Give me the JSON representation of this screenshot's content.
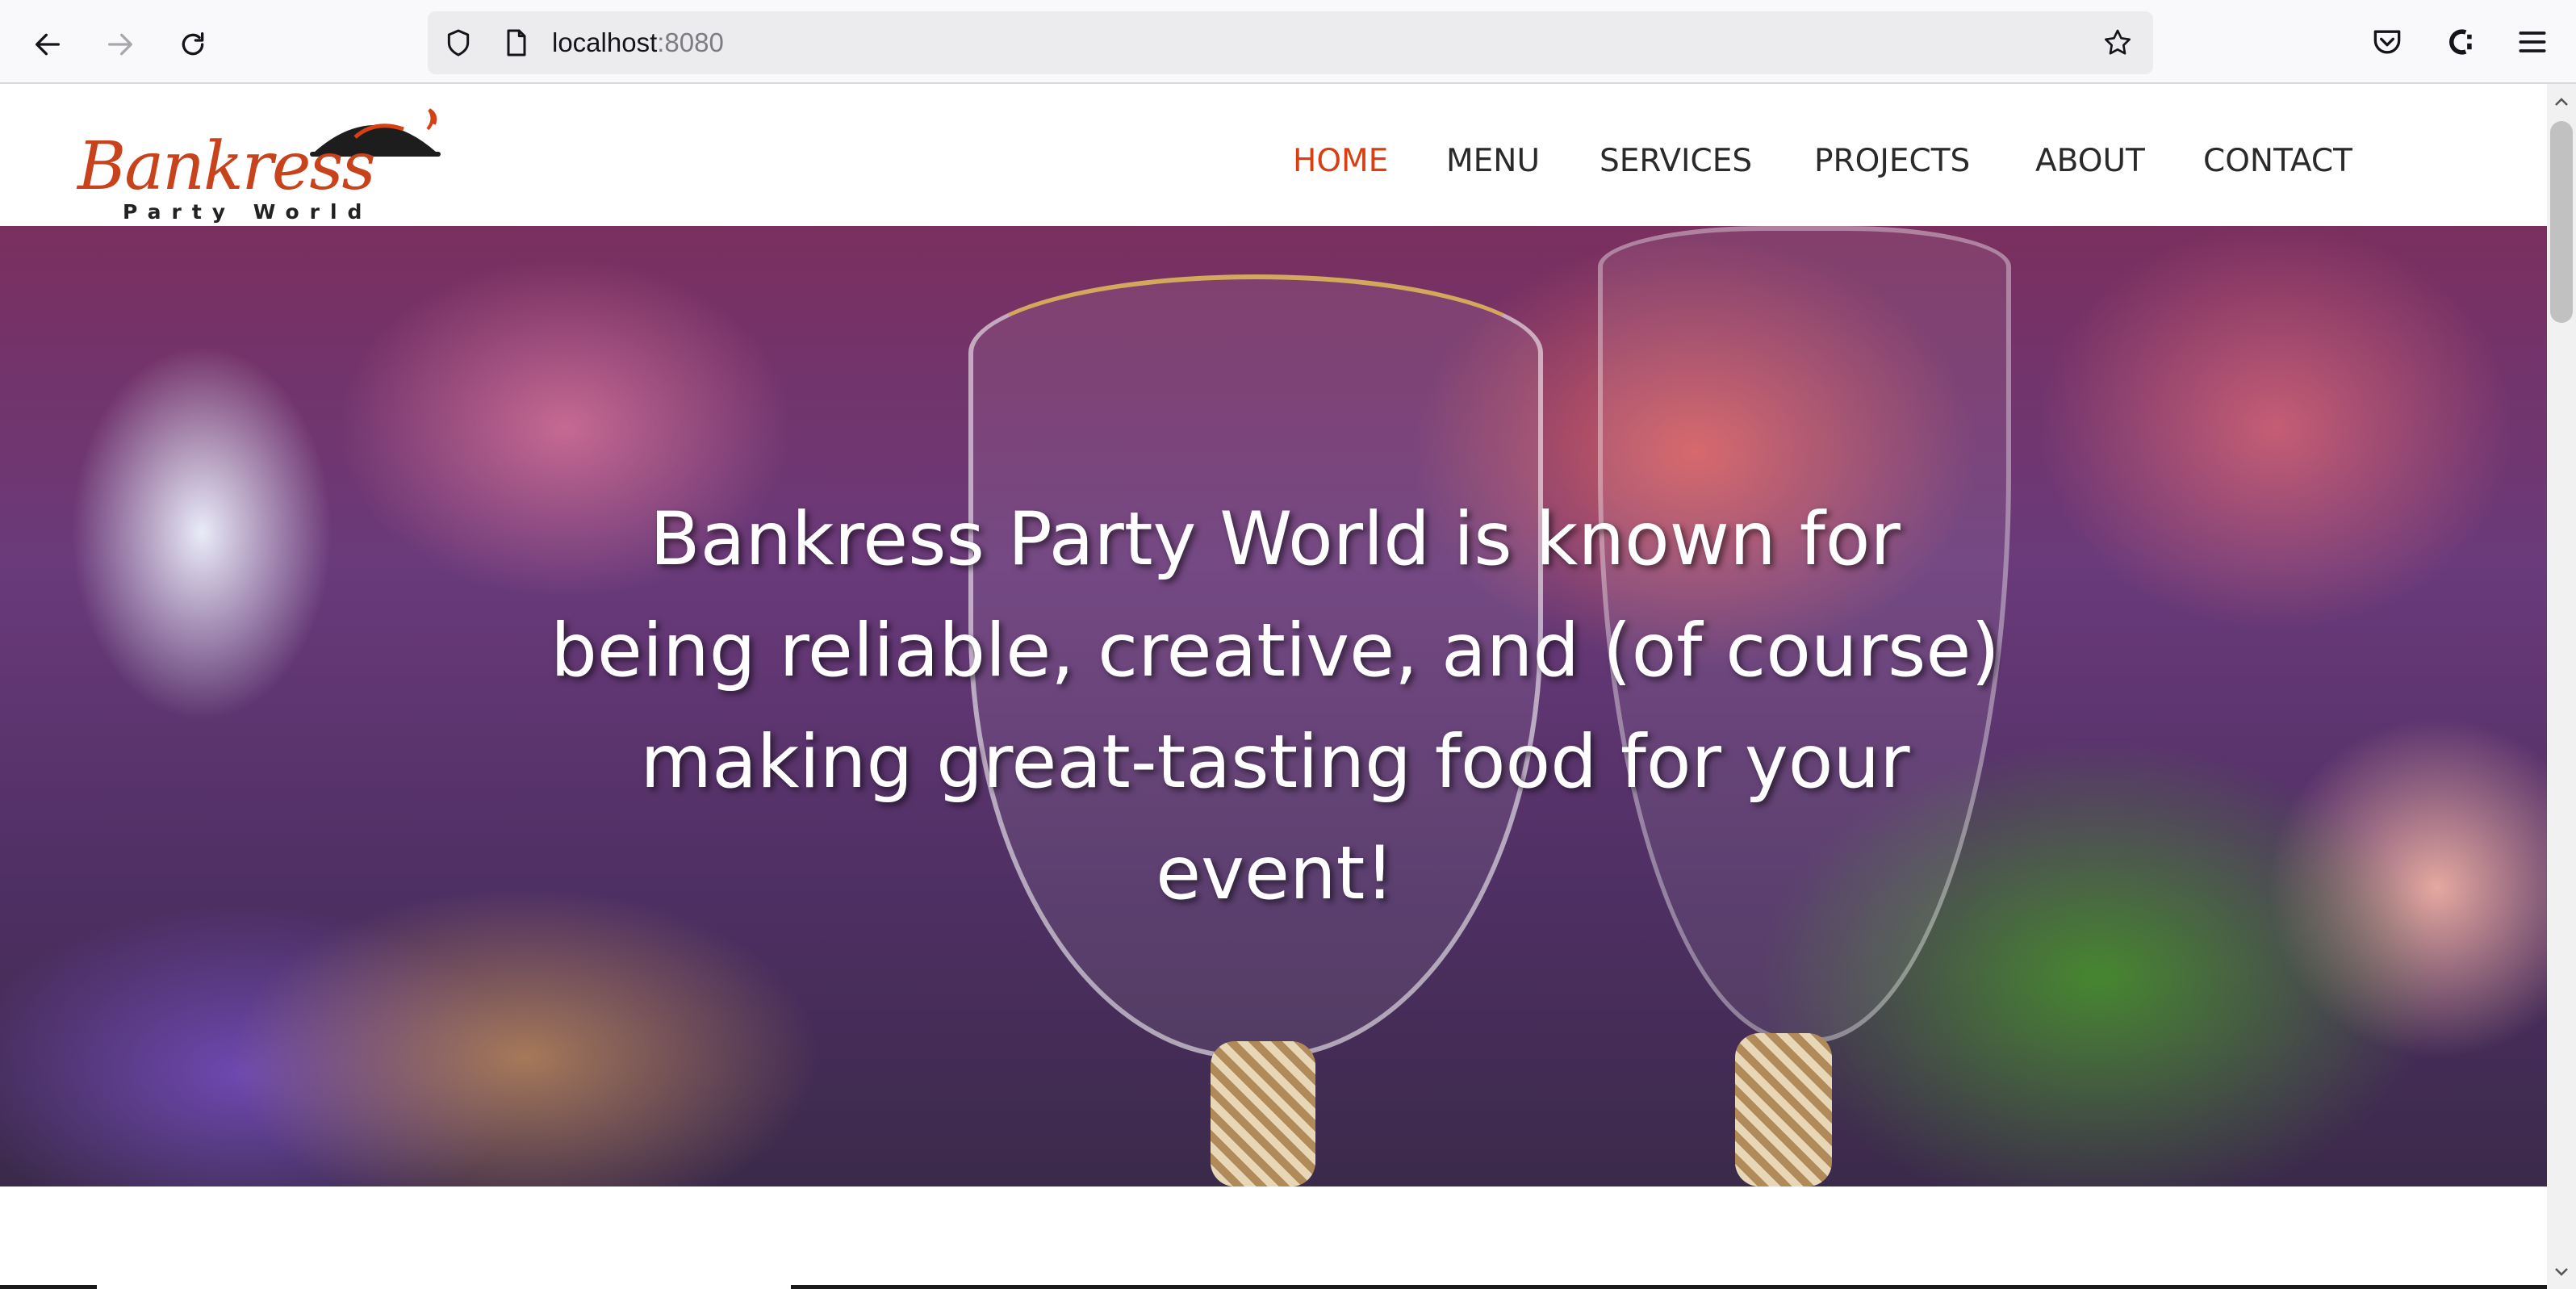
{
  "browser": {
    "url_host": "localhost",
    "url_port": ":8080",
    "icons": [
      "back-icon",
      "forward-icon",
      "reload-icon",
      "shield-icon",
      "page-icon",
      "bookmark-star-icon",
      "pocket-icon",
      "extension-icon",
      "menu-icon"
    ]
  },
  "site": {
    "logo": {
      "name": "Bankress",
      "tagline": "Party World"
    },
    "nav": [
      {
        "label": "HOME",
        "active": true
      },
      {
        "label": "MENU",
        "active": false
      },
      {
        "label": "SERVICES",
        "active": false
      },
      {
        "label": "PROJECTS",
        "active": false
      },
      {
        "label": "ABOUT",
        "active": false
      },
      {
        "label": "CONTACT",
        "active": false
      }
    ],
    "hero": {
      "text": "Bankress Party World is known for\nbeing reliable, creative, and (of course)\nmaking great-tasting food for your\nevent!"
    }
  },
  "colors": {
    "accent": "#d64012",
    "nav_text": "#2a2a2a",
    "chrome_bg": "#f9f9fb"
  }
}
